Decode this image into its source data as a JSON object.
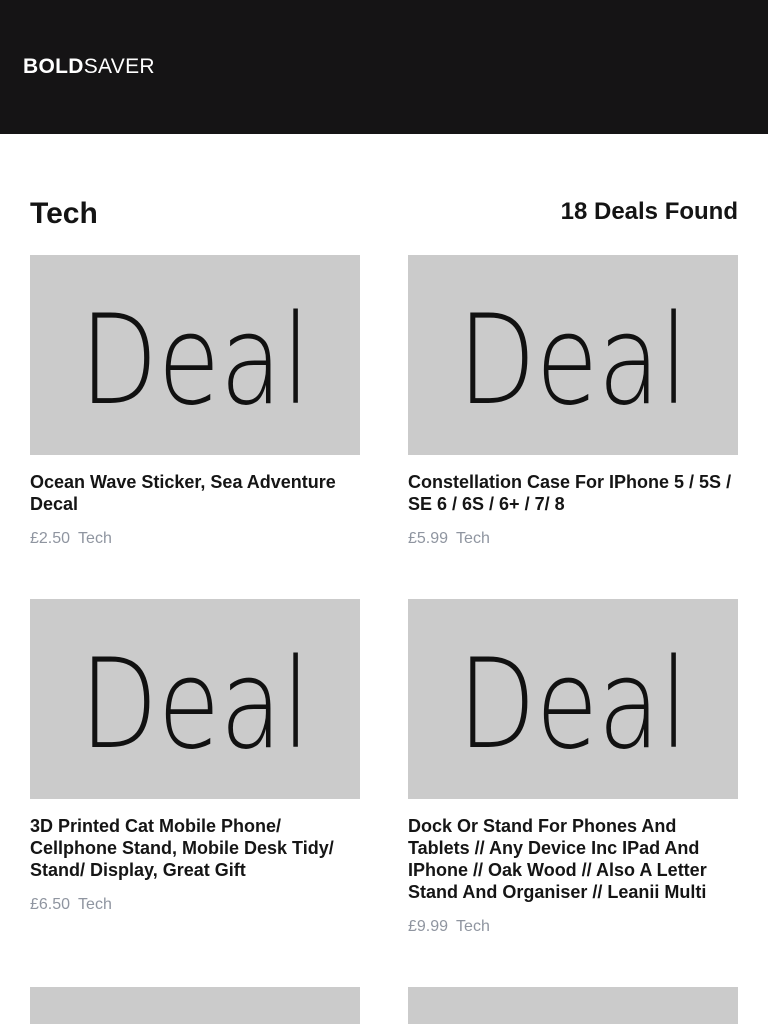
{
  "header": {
    "logo_bold": "BOLD",
    "logo_light": "SAVER"
  },
  "page": {
    "title": "Tech",
    "deal_count": "18 Deals Found"
  },
  "placeholder_image_text": "Deal",
  "colors": {
    "header_bg": "#151415",
    "thumb_bg": "#cbcbcb",
    "meta_text": "#8f95a0"
  },
  "deals": [
    {
      "title": "Ocean Wave Sticker, Sea Adventure Decal",
      "price": "£2.50",
      "category": "Tech"
    },
    {
      "title": "Constellation Case For IPhone 5 / 5S / SE 6 / 6S / 6+ / 7/ 8",
      "price": "£5.99",
      "category": "Tech"
    },
    {
      "title": "3D Printed Cat Mobile Phone/ Cellphone Stand, Mobile Desk Tidy/ Stand/ Display, Great Gift",
      "price": "£6.50",
      "category": "Tech"
    },
    {
      "title": "Dock Or Stand For Phones And Tablets // Any Device Inc IPad And IPhone // Oak Wood // Also A Letter Stand And Organiser // Leanii Multi",
      "price": "£9.99",
      "category": "Tech"
    }
  ]
}
